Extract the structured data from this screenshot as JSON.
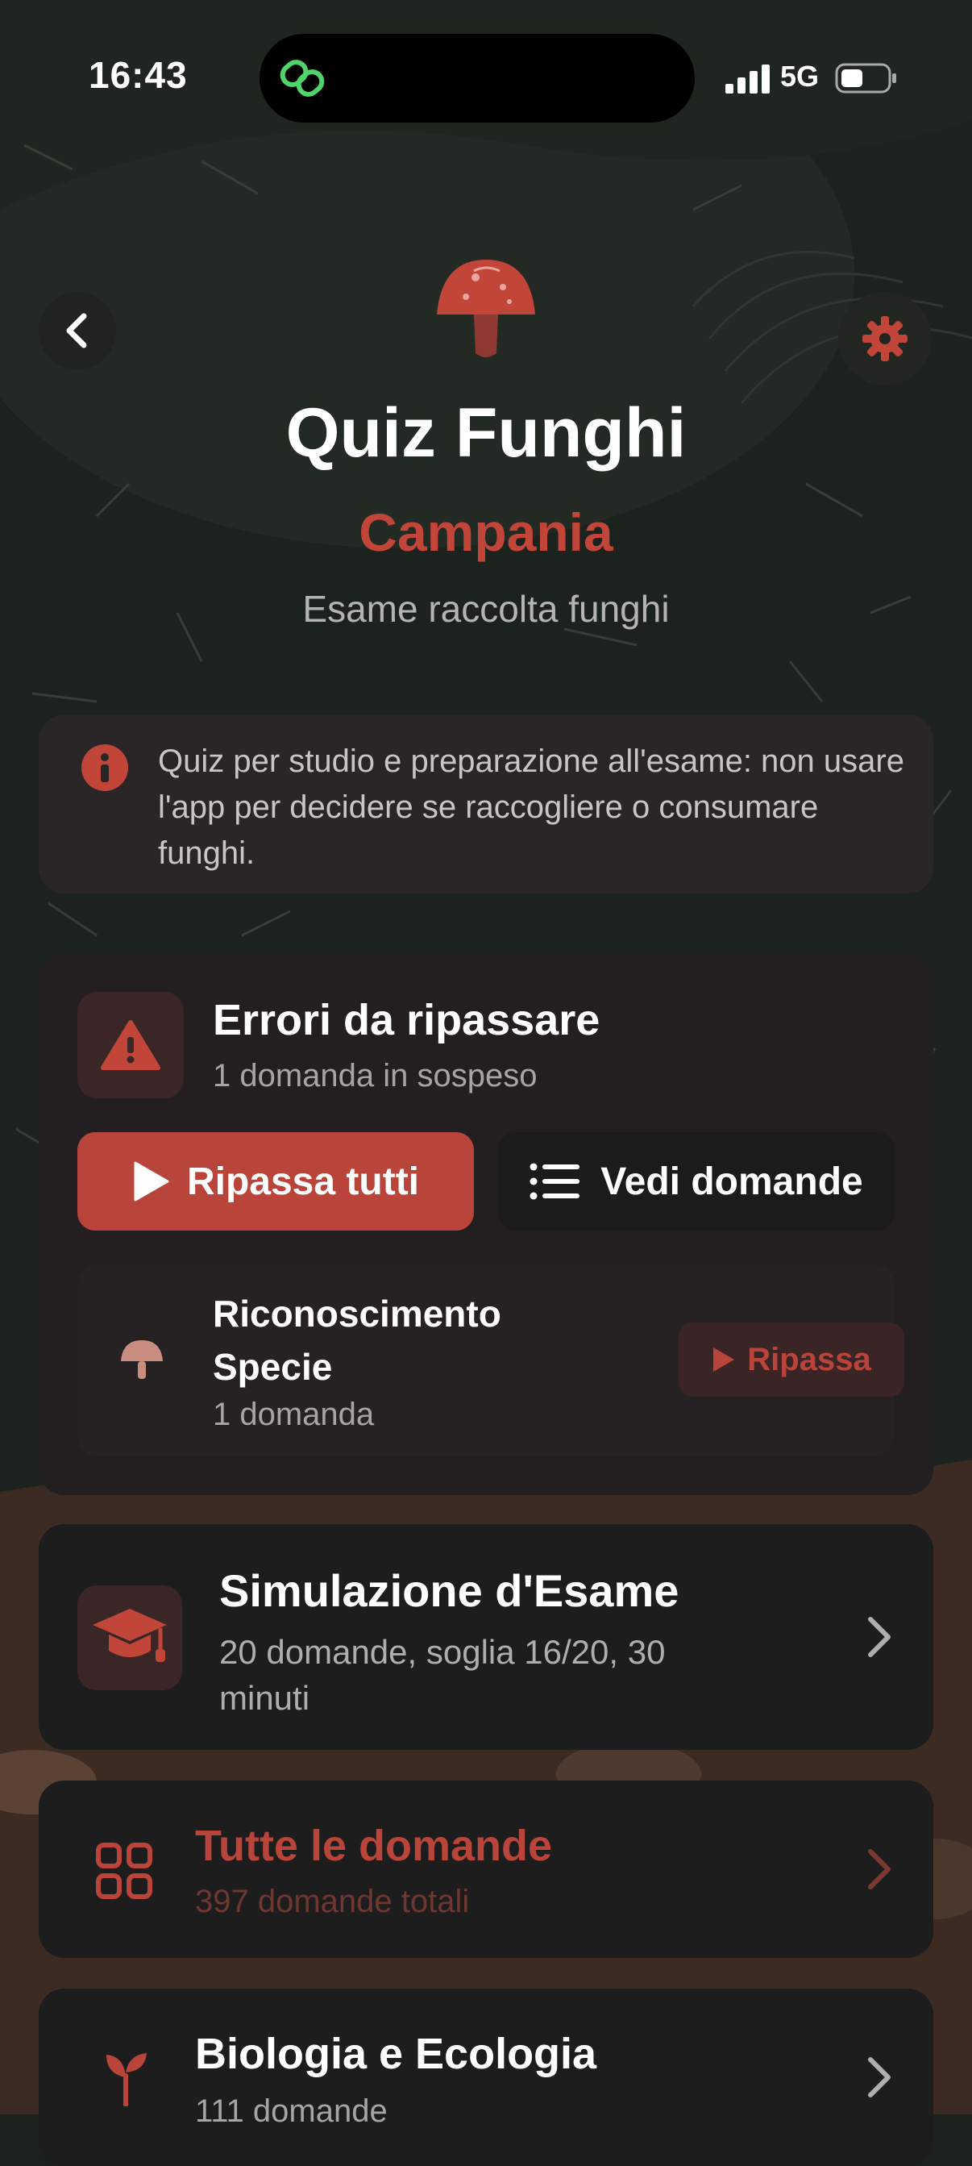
{
  "status_bar": {
    "time": "16:43",
    "network": "5G"
  },
  "header": {
    "title": "Quiz Funghi",
    "region": "Campania",
    "subtitle": "Esame raccolta funghi"
  },
  "disclaimer": {
    "text": "Quiz per studio e preparazione all'esame: non usare l'app per decidere se raccogliere o consumare funghi."
  },
  "errors_card": {
    "title": "Errori da ripassare",
    "subtitle": "1 domanda in sospeso",
    "review_all_label": "Ripassa tutti",
    "view_questions_label": "Vedi domande",
    "category": {
      "title": "Riconoscimento Specie",
      "count": "1 domanda",
      "review_label": "Ripassa"
    }
  },
  "exam_simulation": {
    "title": "Simulazione d'Esame",
    "subtitle": "20 domande, soglia 16/20, 30 minuti"
  },
  "all_questions": {
    "title": "Tutte le domande",
    "subtitle": "397 domande totali"
  },
  "biology": {
    "title": "Biologia e Ecologia",
    "subtitle": "111 domande"
  },
  "colors": {
    "accent": "#b8443a",
    "background": "#1b211c",
    "card": "#231f21"
  },
  "icons": [
    "app-link-icon",
    "signal-icon",
    "battery-icon",
    "back-icon",
    "gear-icon",
    "mushroom-icon",
    "info-icon",
    "warning-icon",
    "play-icon",
    "list-icon",
    "graduation-cap-icon",
    "chevron-right-icon",
    "grid-icon",
    "sprout-icon"
  ]
}
